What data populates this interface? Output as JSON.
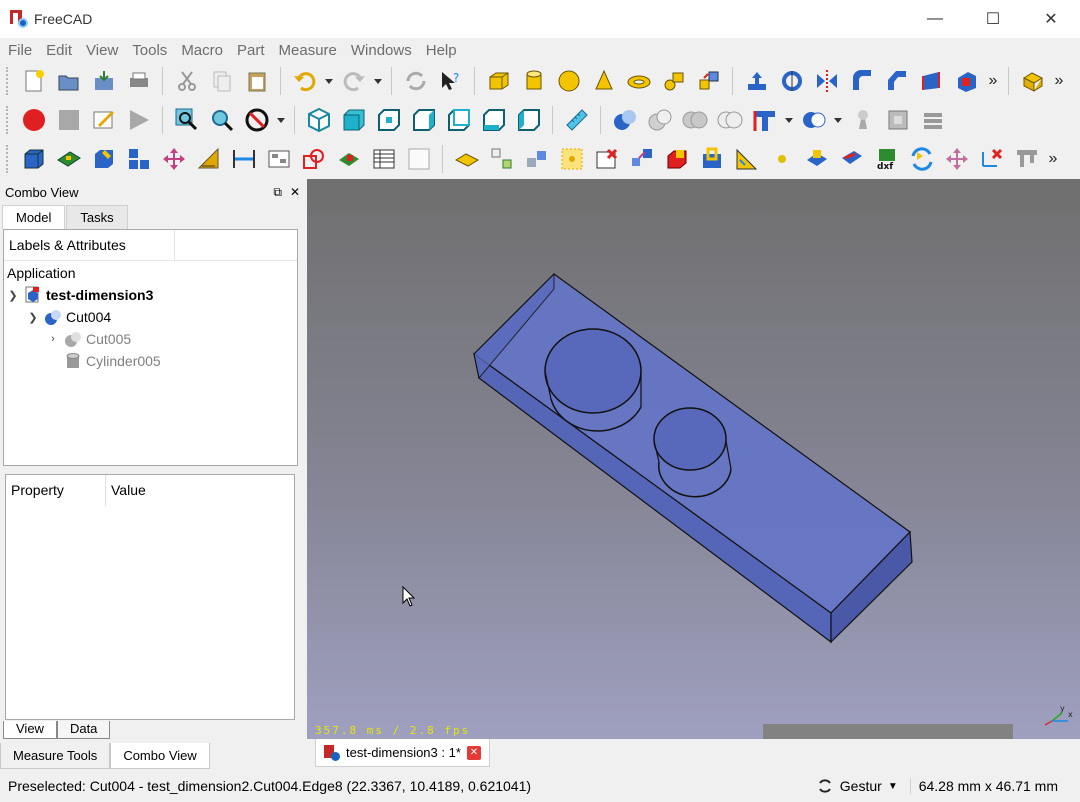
{
  "window": {
    "title": "FreeCAD",
    "minimize": "—",
    "maximize": "☐",
    "close": "✕"
  },
  "menu": [
    "File",
    "Edit",
    "View",
    "Tools",
    "Macro",
    "Part",
    "Measure",
    "Windows",
    "Help"
  ],
  "combo": {
    "title": "Combo View",
    "float_glyph": "⧉",
    "close_glyph": "✕",
    "tabs": [
      "Model",
      "Tasks"
    ],
    "tree_header": "Labels & Attributes",
    "tree_root": "Application",
    "tree": [
      {
        "label": "test-dimension3",
        "expanded": true
      },
      {
        "label": "Cut004",
        "expanded": true
      },
      {
        "label": "Cut005",
        "expanded": false
      },
      {
        "label": "Cylinder005"
      }
    ],
    "prop_headers": [
      "Property",
      "Value"
    ],
    "view_tabs": [
      "View",
      "Data"
    ]
  },
  "bottom_tabs": [
    "Measure Tools",
    "Combo View"
  ],
  "viewport": {
    "fps_text": "357.8 ms / 2.8 fps"
  },
  "doc_tab": {
    "label": "test-dimension3 : 1*"
  },
  "status": {
    "text": "Preselected: Cut004 - test_dimension2.Cut004.Edge8 (22.3367, 10.4189, 0.621041)",
    "nav_style": "Gestur",
    "dimensions": "64.28 mm x 46.71 mm"
  },
  "toolbar_more": "»",
  "colors": {
    "accent_blue": "#1e88e5",
    "part_yellow": "#f2c500",
    "model_fill": "#5c6fc0",
    "record_red": "#e02020"
  }
}
